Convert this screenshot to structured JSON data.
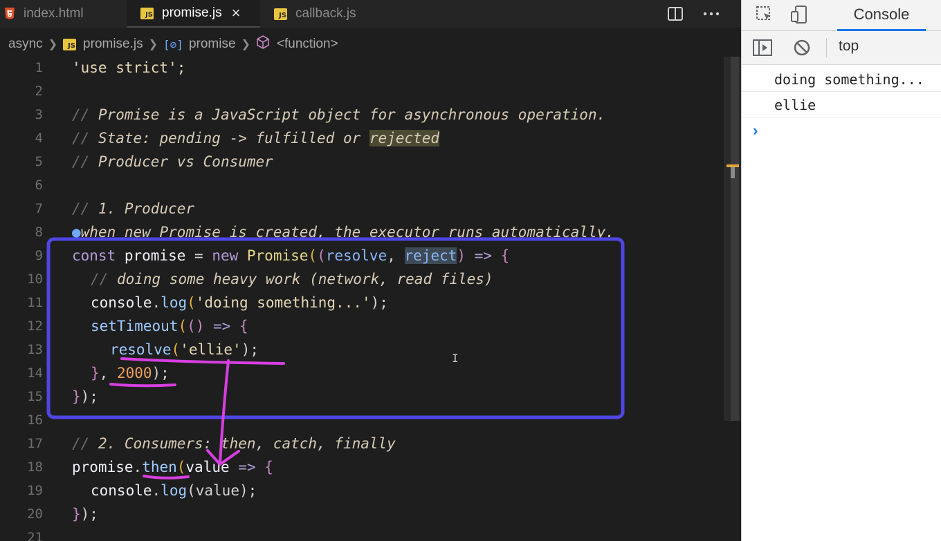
{
  "tabs": [
    {
      "label": "index.html",
      "icon": "html5-icon",
      "active": false
    },
    {
      "label": "promise.js",
      "icon": "js-icon",
      "active": true
    },
    {
      "label": "callback.js",
      "icon": "js-icon",
      "active": false
    }
  ],
  "tab_js_badge": "JS",
  "breadcrumb": {
    "folder": "async",
    "file": "promise.js",
    "symbol": "promise",
    "function": "<function>"
  },
  "line_numbers": [
    "1",
    "2",
    "3",
    "4",
    "5",
    "6",
    "7",
    "8",
    "9",
    "10",
    "11",
    "12",
    "13",
    "14",
    "15",
    "16",
    "17",
    "18",
    "19",
    "20",
    "21"
  ],
  "code": {
    "l1": "'use strict';",
    "l3_slash": "// ",
    "l3": "Promise is a JavaScript object for asynchronous operation.",
    "l4_slash": "// ",
    "l4a": "State: pending -> fulfilled or ",
    "l4b": "rejected",
    "l5_slash": "// ",
    "l5": "Producer vs Consumer",
    "l7_slash": "// ",
    "l7": "1. Producer",
    "l8": "when new Promise is created, the executor runs automatically.",
    "l9_const": "const",
    "l9_name": " promise ",
    "l9_eq": "= ",
    "l9_new": "new ",
    "l9_promise": "Promise",
    "l9_open": "(",
    "l9_paren": "(",
    "l9_resolve": "resolve",
    "l9_comma": ", ",
    "l9_reject": "reject",
    "l9_close": ")",
    "l9_arrow": " => ",
    "l9_brace": "{",
    "l10_slash": "// ",
    "l10": "doing some heavy work (network, read files)",
    "l11_console": "console",
    "l11_dot": ".",
    "l11_log": "log",
    "l11_open": "(",
    "l11_str": "'doing something...'",
    "l11_close": ");",
    "l12_fn": "setTimeout",
    "l12_open": "(",
    "l12_p": "()",
    "l12_arrow": " => ",
    "l12_brace": "{",
    "l13_fn": "resolve",
    "l13_open": "(",
    "l13_str": "'ellie'",
    "l13_close": ");",
    "l14_brace": "}",
    "l14_comma": ", ",
    "l14_num": "2000",
    "l14_close": ");",
    "l15_brace": "}",
    "l15_close": ");",
    "l17_slash": "// ",
    "l17": "2. Consumers: then, catch, finally",
    "l18_obj": "promise",
    "l18_dot": ".",
    "l18_then": "then",
    "l18_open": "(",
    "l18_val": "value",
    "l18_arrow": " => ",
    "l18_brace": "{",
    "l19_console": "console",
    "l19_dot": ".",
    "l19_log": "log",
    "l19_args": "(value);",
    "l20_brace": "}",
    "l20_close": ");"
  },
  "devtools": {
    "tab_label": "Console",
    "context": "top",
    "messages": [
      "doing something...",
      "ellie"
    ],
    "prompt": "›"
  },
  "colors": {
    "editor_bg": "#1e1e1e",
    "annotation_box": "#4f46e5",
    "annotation_pen": "#d63fe0",
    "console_accent": "#1a73e8"
  }
}
